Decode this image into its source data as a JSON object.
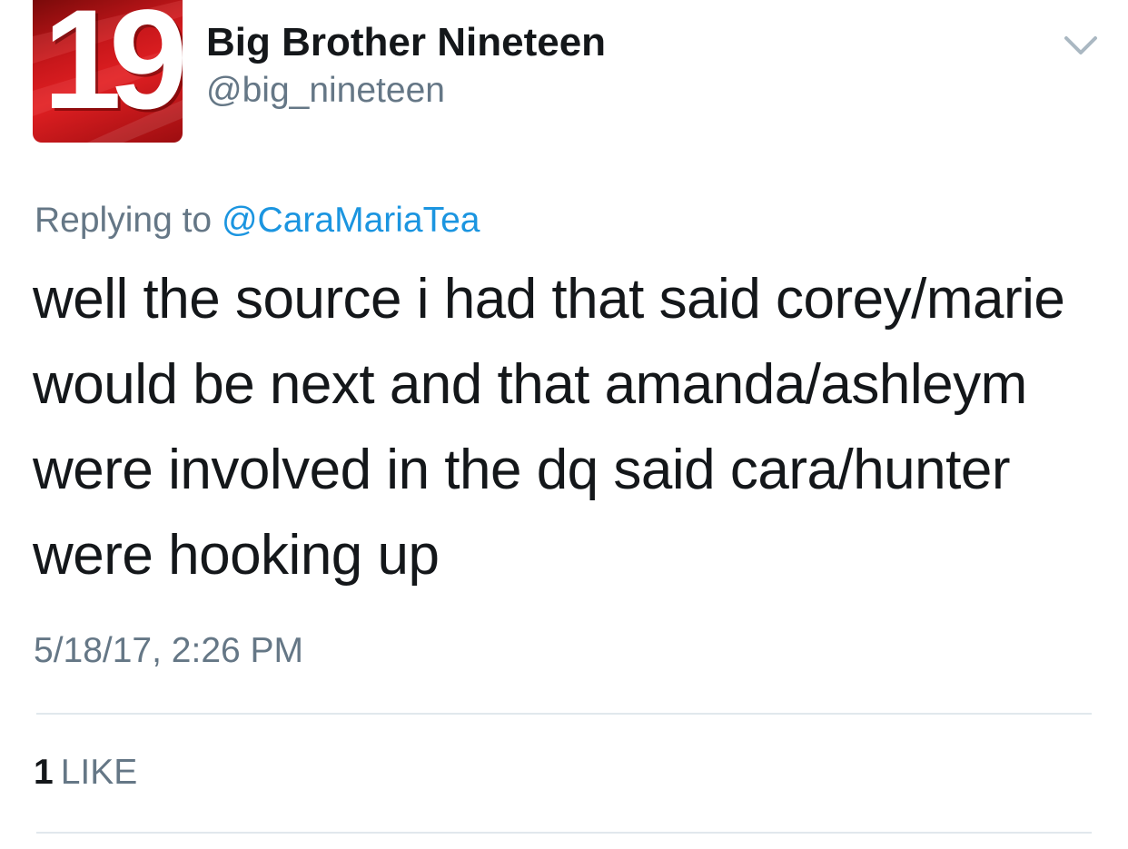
{
  "tweet": {
    "avatar": {
      "number": "19",
      "background_color": "#c8171b"
    },
    "display_name": "Big Brother Nineteen",
    "handle": "@big_nineteen",
    "menu_icon": "chevron-down-icon",
    "reply_prefix": "Replying to",
    "reply_mention": "@CaraMariaTea",
    "text_lines": [
      "well the source i had that said corey/marie",
      "would be next and that amanda/ashleym",
      "were involved in the dq said cara/hunter",
      "were hooking up"
    ],
    "timestamp": "5/18/17, 2:26 PM",
    "likes": {
      "count": "1",
      "label": "LIKE"
    },
    "colors": {
      "text": "#14171a",
      "secondary": "#657786",
      "link": "#1b95e0",
      "divider": "#e1e8ed"
    }
  }
}
